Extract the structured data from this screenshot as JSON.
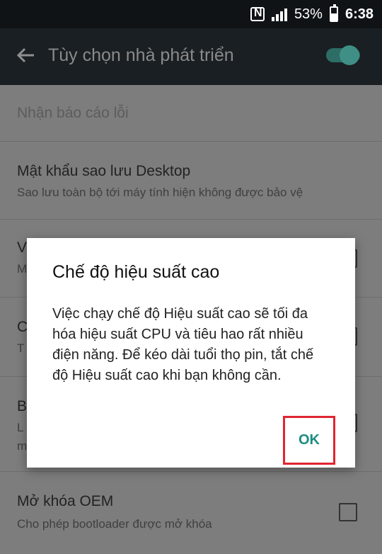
{
  "status_bar": {
    "battery_percent": "53%",
    "time": "6:38",
    "icons": [
      "nfc-icon",
      "signal-icon",
      "battery-icon"
    ]
  },
  "app_bar": {
    "title": "Tùy chọn nhà phát triển",
    "back_icon": "arrow-left-icon",
    "toggle_on": true
  },
  "settings": [
    {
      "title": "Nhận báo cáo lỗi",
      "subtitle": ""
    },
    {
      "title": "Mật khẩu sao lưu Desktop",
      "subtitle": "Sao lưu toàn bộ tới máy tính hiện không được bảo vệ"
    },
    {
      "title": "V",
      "subtitle": "M"
    },
    {
      "title": "C",
      "subtitle": "T"
    },
    {
      "title": "B",
      "subtitle": "L",
      "subtitle2": "m"
    },
    {
      "title": "Mở khóa OEM",
      "subtitle": "Cho phép bootloader được mở khóa"
    }
  ],
  "dialog": {
    "title": "Chế độ hiệu suất cao",
    "body": "Việc chạy chế độ Hiệu suất cao sẽ tối đa hóa hiệu suất CPU và tiêu hao rất nhiều điện năng. Để kéo dài tuổi thọ pin, tắt chế độ Hiệu suất cao khi bạn không cần.",
    "ok_label": "OK"
  },
  "colors": {
    "accent": "#1c8c83",
    "highlight_border": "#e02630"
  }
}
